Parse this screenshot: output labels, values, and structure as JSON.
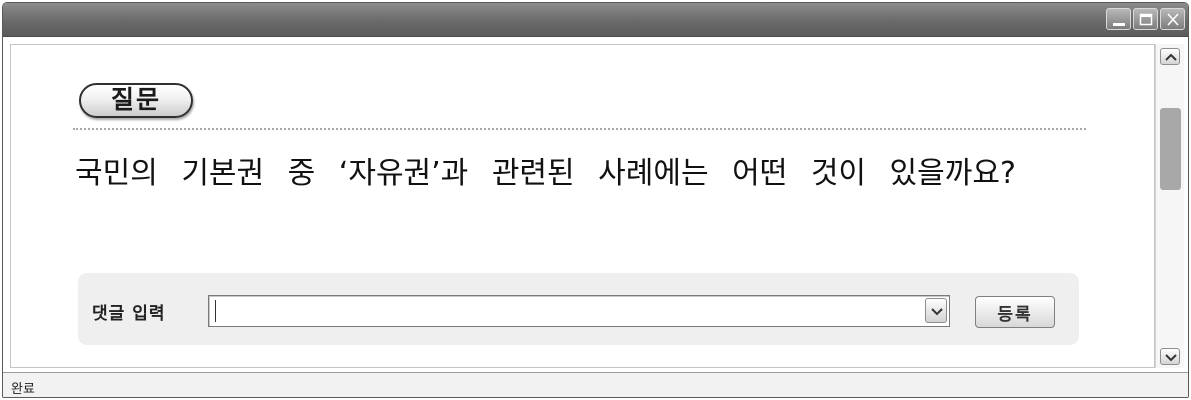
{
  "window": {
    "controls": [
      "minimize-icon",
      "maximize-icon",
      "close-icon"
    ]
  },
  "question": {
    "badge": "질문",
    "text": "국민의 기본권 중 ‘자유권’과 관련된 사례에는 어떤 것이 있을까요?"
  },
  "comment": {
    "label": "댓글 입력",
    "value": "",
    "submit_label": "등록"
  },
  "status": {
    "text": "완료"
  }
}
